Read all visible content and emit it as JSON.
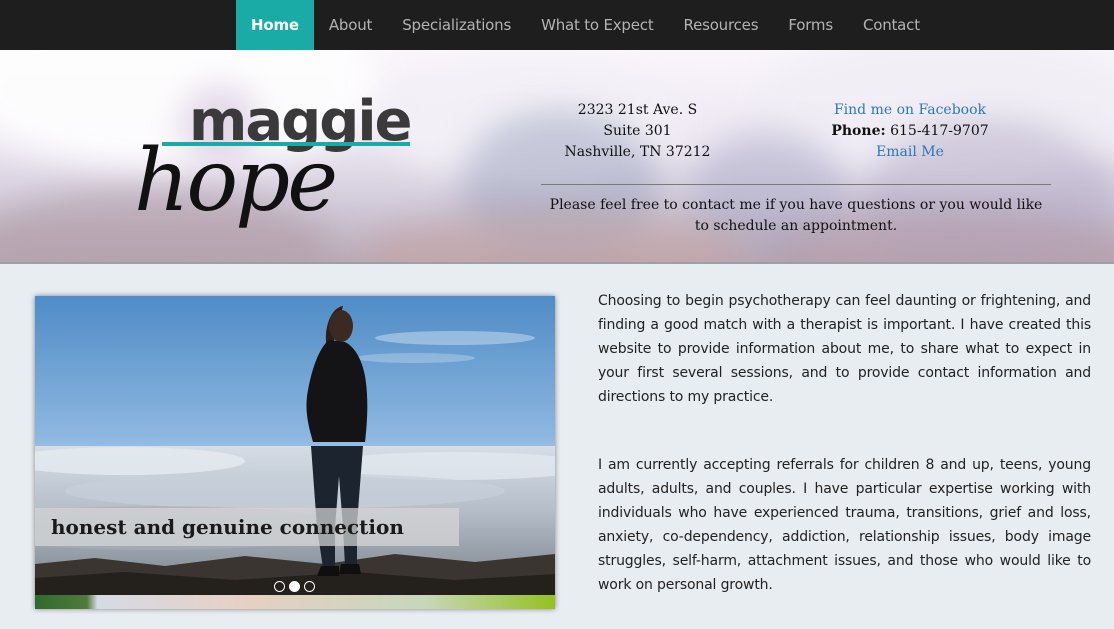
{
  "nav": {
    "items": [
      {
        "label": "Home",
        "active": true
      },
      {
        "label": "About",
        "active": false
      },
      {
        "label": "Specializations",
        "active": false
      },
      {
        "label": "What to Expect",
        "active": false
      },
      {
        "label": "Resources",
        "active": false
      },
      {
        "label": "Forms",
        "active": false
      },
      {
        "label": "Contact",
        "active": false
      }
    ]
  },
  "logo": {
    "line1": "maggie",
    "line2": "hope"
  },
  "address": {
    "line1": "2323 21st Ave. S",
    "line2": "Suite 301",
    "line3": "Nashville, TN 37212"
  },
  "contact": {
    "facebook_link": "Find me on Facebook",
    "phone_label": "Phone:",
    "phone_value": "615-417-9707",
    "email_link": "Email Me"
  },
  "header_note": "Please feel free to contact me if you have questions or you would like to schedule an appointment.",
  "slider": {
    "caption": "honest and genuine connection",
    "dot_count": 3,
    "active_dot": 2
  },
  "intro": {
    "paragraph1": "Choosing to begin psychotherapy can feel daunting or frightening, and finding a good match with a therapist is important. I have created this website to provide information about me, to share what to expect in your first several sessions, and to provide contact information and directions to my practice.",
    "paragraph2": "I am currently accepting referrals for children 8 and up, teens, young adults, adults, and couples. I have particular expertise working with individuals who have experienced trauma, transitions, grief and loss, anxiety, co-dependency, addiction, relationship issues, body image struggles, self-harm, attachment issues, and those who would like to work on personal growth."
  },
  "colors": {
    "nav_bg": "#1e1e1e",
    "nav_active": "#1aaba7",
    "link": "#2e78b7",
    "logo_teal": "#1aaba7",
    "page_bg": "#e8edf1"
  }
}
